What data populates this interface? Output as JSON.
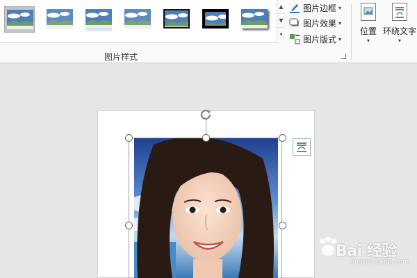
{
  "ribbon": {
    "group_label": "图片样式",
    "commands": [
      {
        "label": "图片边框",
        "icon": "pen-border-icon"
      },
      {
        "label": "图片效果",
        "icon": "picture-effects-icon"
      },
      {
        "label": "图片版式",
        "icon": "picture-layout-icon"
      }
    ],
    "big_buttons": [
      {
        "label": "位置",
        "icon": "position-icon"
      },
      {
        "label": "环绕文字",
        "icon": "wrap-text-icon"
      }
    ],
    "style_thumbnails": [
      {
        "style": "simple-frame-white",
        "selected": true
      },
      {
        "style": "soft-edge"
      },
      {
        "style": "reflected"
      },
      {
        "style": "soft-edge-rectangle"
      },
      {
        "style": "simple-frame-black"
      },
      {
        "style": "thick-matte-black"
      },
      {
        "style": "black-drop-shadow"
      }
    ]
  },
  "watermark": {
    "main": "Bai 经验",
    "sub": "jingyan.baidu.com"
  },
  "colors": {
    "ribbon_bg": "#fafafa",
    "workspace_bg": "#e6e6e6",
    "sky": "#4f7fb8",
    "hill": "#6e9a6a"
  }
}
